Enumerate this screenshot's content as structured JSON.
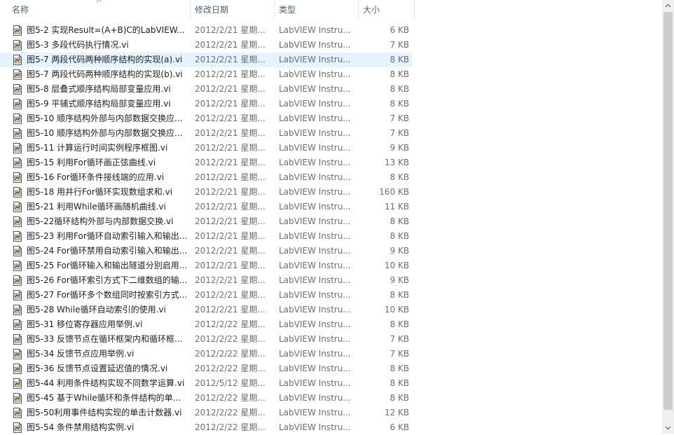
{
  "columns": {
    "name": "名称",
    "date": "修改日期",
    "type": "类型",
    "size": "大小"
  },
  "highlight_index": 2,
  "files": [
    {
      "name": "图5-2 实现Result=(A+B)C的LabVIEW...",
      "date": "2012/2/21 星期...",
      "type": "LabVIEW Instru...",
      "size": "6 KB"
    },
    {
      "name": "图5-3 多段代码执行情况.vi",
      "date": "2012/2/21 星期...",
      "type": "LabVIEW Instru...",
      "size": "7 KB"
    },
    {
      "name": "图5-7 两段代码两种顺序结构的实现(a).vi",
      "date": "2012/2/21 星期...",
      "type": "LabVIEW Instru...",
      "size": "8 KB"
    },
    {
      "name": "图5-7 两段代码两种顺序结构的实现(b).vi",
      "date": "2012/2/21 星期...",
      "type": "LabVIEW Instru...",
      "size": "8 KB"
    },
    {
      "name": "图5-8 层叠式顺序结构局部变量应用.vi",
      "date": "2012/2/21 星期...",
      "type": "LabVIEW Instru...",
      "size": "8 KB"
    },
    {
      "name": "图5-9 平铺式顺序结构局部变量应用.vi",
      "date": "2012/2/21 星期...",
      "type": "LabVIEW Instru...",
      "size": "8 KB"
    },
    {
      "name": "图5-10 顺序结构外部与内部数据交换应...",
      "date": "2012/2/21 星期...",
      "type": "LabVIEW Instru...",
      "size": "7 KB"
    },
    {
      "name": "图5-10 顺序结构外部与内部数据交换应...",
      "date": "2012/2/21 星期...",
      "type": "LabVIEW Instru...",
      "size": "7 KB"
    },
    {
      "name": "图5-11 计算运行时间实例程序框图.vi",
      "date": "2012/2/21 星期...",
      "type": "LabVIEW Instru...",
      "size": "9 KB"
    },
    {
      "name": "图5-15 利用For循环画正弦曲线.vi",
      "date": "2012/2/21 星期...",
      "type": "LabVIEW Instru...",
      "size": "13 KB"
    },
    {
      "name": "图5-16  For循环条件接线端的应用.vi",
      "date": "2012/2/21 星期...",
      "type": "LabVIEW Instru...",
      "size": "8 KB"
    },
    {
      "name": "图5-18 用并行For循环实现数组求和.vi",
      "date": "2012/2/21 星期...",
      "type": "LabVIEW Instru...",
      "size": "160 KB"
    },
    {
      "name": "图5-21 利用While循环画随机曲线.vi",
      "date": "2012/2/21 星期...",
      "type": "LabVIEW Instru...",
      "size": "11 KB"
    },
    {
      "name": "图5-22循环结构外部与内部数据交换.vi",
      "date": "2012/2/21 星期...",
      "type": "LabVIEW Instru...",
      "size": "8 KB"
    },
    {
      "name": "图5-23 利用For循环自动索引输入和输出...",
      "date": "2012/2/21 星期...",
      "type": "LabVIEW Instru...",
      "size": "8 KB"
    },
    {
      "name": "图5-24 For循环禁用自动索引输入和输出...",
      "date": "2012/2/21 星期...",
      "type": "LabVIEW Instru...",
      "size": "9 KB"
    },
    {
      "name": "图5-25 For循环输入和输出隧道分别启用...",
      "date": "2012/2/21 星期...",
      "type": "LabVIEW Instru...",
      "size": "10 KB"
    },
    {
      "name": "图5-26 For循环索引方式下二维数组的输...",
      "date": "2012/2/21 星期...",
      "type": "LabVIEW Instru...",
      "size": "9 KB"
    },
    {
      "name": "图5-27 For循环多个数组同时按索引方式...",
      "date": "2012/2/21 星期...",
      "type": "LabVIEW Instru...",
      "size": "8 KB"
    },
    {
      "name": "图5-28 While循环自动索引的使用.vi",
      "date": "2012/2/21 星期...",
      "type": "LabVIEW Instru...",
      "size": "10 KB"
    },
    {
      "name": "图5-31 移位寄存器应用举例.vi",
      "date": "2012/2/22 星期...",
      "type": "LabVIEW Instru...",
      "size": "8 KB"
    },
    {
      "name": "图5-33 反馈节点在循环框架内和循环框...",
      "date": "2012/2/22 星期...",
      "type": "LabVIEW Instru...",
      "size": "7 KB"
    },
    {
      "name": "图5-34 反馈节点应用举例.vi",
      "date": "2012/2/22 星期...",
      "type": "LabVIEW Instru...",
      "size": "7 KB"
    },
    {
      "name": "图5-36 反馈节点设置延迟值的情况.vi",
      "date": "2012/2/22 星期...",
      "type": "LabVIEW Instru...",
      "size": "8 KB"
    },
    {
      "name": "图5-44 利用条件结构实现不同数学运算.vi",
      "date": "2012/5/12 星期...",
      "type": "LabVIEW Instru...",
      "size": "8 KB"
    },
    {
      "name": "图5-45 基于While循环和条件结构的单...",
      "date": "2012/2/22 星期...",
      "type": "LabVIEW Instru...",
      "size": "8 KB"
    },
    {
      "name": "图5-50利用事件结构实现的单击计数器.vi",
      "date": "2012/2/22 星期...",
      "type": "LabVIEW Instru...",
      "size": "12 KB"
    },
    {
      "name": "图5-54 条件禁用结构实例.vi",
      "date": "2012/2/22 星期...",
      "type": "LabVIEW Instru...",
      "size": "6 KB"
    }
  ]
}
